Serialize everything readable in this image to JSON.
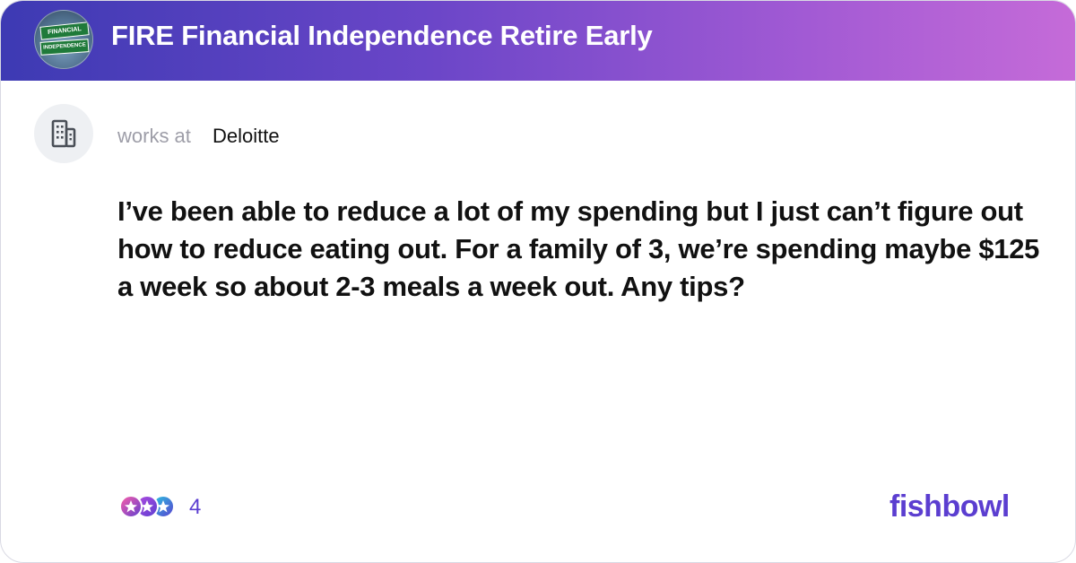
{
  "bowl": {
    "title": "FIRE Financial Independence Retire Early",
    "avatar_sign_top": "FINANCIAL",
    "avatar_sign_bottom": "INDEPENDENCE",
    "header_gradient": [
      "#3d3ab3",
      "#c56bd8"
    ]
  },
  "author": {
    "works_at_label": "works at",
    "company": "Deloitte",
    "avatar_icon": "building-icon"
  },
  "post": {
    "text": "I’ve been able to reduce a lot of my spending but I just can’t figure out how to reduce eating out. For a family of 3, we’re spending maybe $125 a week so about 2-3 meals a week out. Any tips?"
  },
  "reactions": {
    "icons": [
      "like-reaction-icon",
      "star-reaction-icon",
      "star-reaction-icon"
    ],
    "count": "4"
  },
  "brand": {
    "name": "fishbowl",
    "color": "#5b3ed0"
  }
}
